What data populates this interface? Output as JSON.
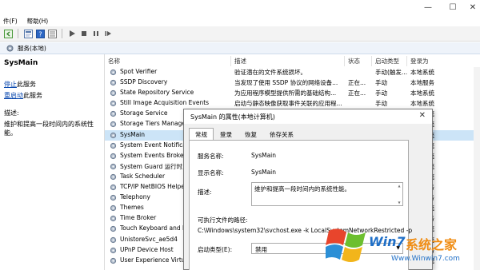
{
  "window": {
    "minimize_glyph": "—",
    "maximize_glyph": "☐",
    "close_glyph": "✕"
  },
  "menu": {
    "items": [
      "件(F)",
      "帮助(H)"
    ]
  },
  "header": {
    "title": "服务(本地)"
  },
  "left_pane": {
    "service_name": "SysMain",
    "stop_link": "停止",
    "stop_suffix": "此服务",
    "restart_link": "重启动",
    "restart_suffix": "此服务",
    "desc_label": "描述:",
    "desc_text": "维护和提高一段时间内的系统性能。"
  },
  "columns": {
    "name": "名称",
    "description": "描述",
    "status": "状态",
    "startup": "启动类型",
    "logon": "登录为"
  },
  "rows": [
    {
      "name": "Spot Verifier",
      "desc": "验证潜在的文件系统损坏。",
      "status": "",
      "startup": "手动(触发...",
      "logon": "本地系统"
    },
    {
      "name": "SSDP Discovery",
      "desc": "当发现了使用 SSDP 协议的网络设备...",
      "status": "正在...",
      "startup": "手动",
      "logon": "本地服务"
    },
    {
      "name": "State Repository Service",
      "desc": "为应用程序模型提供所需的基础结构...",
      "status": "正在...",
      "startup": "手动",
      "logon": "本地系统"
    },
    {
      "name": "Still Image Acquisition Events",
      "desc": "启动与静态映像获取事件关联的应用程...",
      "status": "",
      "startup": "手动",
      "logon": "本地系统"
    },
    {
      "name": "Storage Service",
      "desc": "",
      "status": "",
      "startup": "",
      "logon": "本地系统"
    },
    {
      "name": "Storage Tiers Manage",
      "desc": "",
      "status": "",
      "startup": "",
      "logon": "本地系统"
    },
    {
      "name": "SysMain",
      "desc": "",
      "status": "",
      "startup": "",
      "logon": "本地系统"
    },
    {
      "name": "System Event Notificati",
      "desc": "",
      "status": "",
      "startup": "",
      "logon": "本地系统"
    },
    {
      "name": "System Events Broker",
      "desc": "",
      "status": "",
      "startup": "",
      "logon": "本地系统"
    },
    {
      "name": "System Guard 运行时监",
      "desc": "",
      "status": "",
      "startup": "",
      "logon": "本地系统"
    },
    {
      "name": "Task Scheduler",
      "desc": "",
      "status": "",
      "startup": "",
      "logon": "本地系统"
    },
    {
      "name": "TCP/IP NetBIOS Helper",
      "desc": "",
      "status": "",
      "startup": "",
      "logon": "本地服务"
    },
    {
      "name": "Telephony",
      "desc": "",
      "status": "",
      "startup": "",
      "logon": "网络服务"
    },
    {
      "name": "Themes",
      "desc": "",
      "status": "",
      "startup": "",
      "logon": "本地系统"
    },
    {
      "name": "Time Broker",
      "desc": "",
      "status": "",
      "startup": "",
      "logon": "本地服务"
    },
    {
      "name": "Touch Keyboard and Ha",
      "desc": "",
      "status": "",
      "startup": "",
      "logon": "本地系统"
    },
    {
      "name": "UnistoreSvc_ae5d4",
      "desc": "",
      "status": "",
      "startup": "",
      "logon": "本地系统"
    },
    {
      "name": "UPnP Device Host",
      "desc": "",
      "status": "",
      "startup": "",
      "logon": "本地服务"
    },
    {
      "name": "User Experience Virtua",
      "desc": "",
      "status": "",
      "startup": "",
      "logon": "本地系统"
    }
  ],
  "dialog": {
    "title": "SysMain 的属性(本地计算机)",
    "close_glyph": "✕",
    "tabs": [
      "常规",
      "登录",
      "恢复",
      "依存关系"
    ],
    "service_name_label": "服务名称:",
    "service_name_value": "SysMain",
    "display_name_label": "显示名称:",
    "display_name_value": "SysMain",
    "desc_label": "描述:",
    "desc_value": "维护和提高一段时间内的系统性能。",
    "exe_path_label": "可执行文件的路径:",
    "exe_path_value": "C:\\Windows\\system32\\svchost.exe -k LocalSystemNetworkRestricted -p",
    "startup_label": "启动类型(E):",
    "startup_value": "禁用"
  },
  "watermark": {
    "brand_a": "Win7",
    "brand_b": "系统之家",
    "url": "Www.Winwin7.com"
  },
  "colors": {
    "selected_row": "#cce4f7",
    "link": "#0645ad",
    "header_band": "#eef3fa",
    "dialog_bg": "#f0f0f0"
  }
}
